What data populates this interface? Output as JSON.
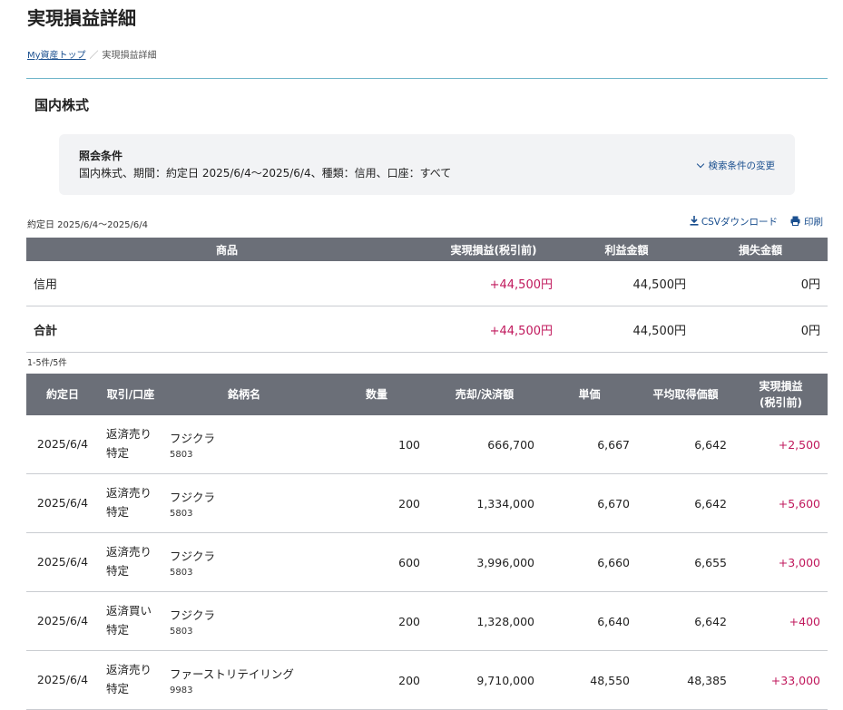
{
  "page": {
    "title": "実現損益詳細",
    "breadcrumb": {
      "link": "My資産トップ",
      "sep": "／",
      "current": "実現損益詳細"
    },
    "section_title": "国内株式"
  },
  "conditions": {
    "title": "照会条件",
    "text": "国内株式、期間：約定日 2025/6/4〜2025/6/4、種類：信用、口座：すべて",
    "change_label": "検索条件の変更"
  },
  "toolbar": {
    "date_range": "約定日 2025/6/4〜2025/6/4",
    "csv_label": "CSVダウンロード",
    "print_label": "印刷"
  },
  "summary": {
    "headers": [
      "商品",
      "実現損益(税引前)",
      "利益金額",
      "損失金額"
    ],
    "rows": [
      {
        "product": "信用",
        "pl": "+44,500円",
        "profit": "44,500円",
        "loss": "0円"
      },
      {
        "product": "合計",
        "pl": "+44,500円",
        "profit": "44,500円",
        "loss": "0円"
      }
    ]
  },
  "details": {
    "count": "1-5件/5件",
    "headers": {
      "date": "約定日",
      "trade": "取引/口座",
      "name": "銘柄名",
      "qty": "数量",
      "amount": "売却/決済額",
      "price": "単価",
      "avg": "平均取得価額",
      "pl_line1": "実現損益",
      "pl_line2": "(税引前)"
    },
    "rows": [
      {
        "date": "2025/6/4",
        "trade": "返済売り",
        "account": "特定",
        "name": "フジクラ",
        "code": "5803",
        "qty": "100",
        "amount": "666,700",
        "price": "6,667",
        "avg": "6,642",
        "pl": "+2,500"
      },
      {
        "date": "2025/6/4",
        "trade": "返済売り",
        "account": "特定",
        "name": "フジクラ",
        "code": "5803",
        "qty": "200",
        "amount": "1,334,000",
        "price": "6,670",
        "avg": "6,642",
        "pl": "+5,600"
      },
      {
        "date": "2025/6/4",
        "trade": "返済売り",
        "account": "特定",
        "name": "フジクラ",
        "code": "5803",
        "qty": "600",
        "amount": "3,996,000",
        "price": "6,660",
        "avg": "6,655",
        "pl": "+3,000"
      },
      {
        "date": "2025/6/4",
        "trade": "返済買い",
        "account": "特定",
        "name": "フジクラ",
        "code": "5803",
        "qty": "200",
        "amount": "1,328,000",
        "price": "6,640",
        "avg": "6,642",
        "pl": "+400"
      },
      {
        "date": "2025/6/4",
        "trade": "返済売り",
        "account": "特定",
        "name": "ファーストリテイリング",
        "code": "9983",
        "qty": "200",
        "amount": "9,710,000",
        "price": "48,550",
        "avg": "48,385",
        "pl": "+33,000"
      }
    ]
  },
  "colors": {
    "header_bg": "#6b6f78",
    "profit": "#c0185c",
    "link": "#1a4f8f",
    "accent_rule": "#6fb5c9"
  },
  "icons": [
    "chevron-down-icon",
    "download-icon",
    "print-icon"
  ]
}
